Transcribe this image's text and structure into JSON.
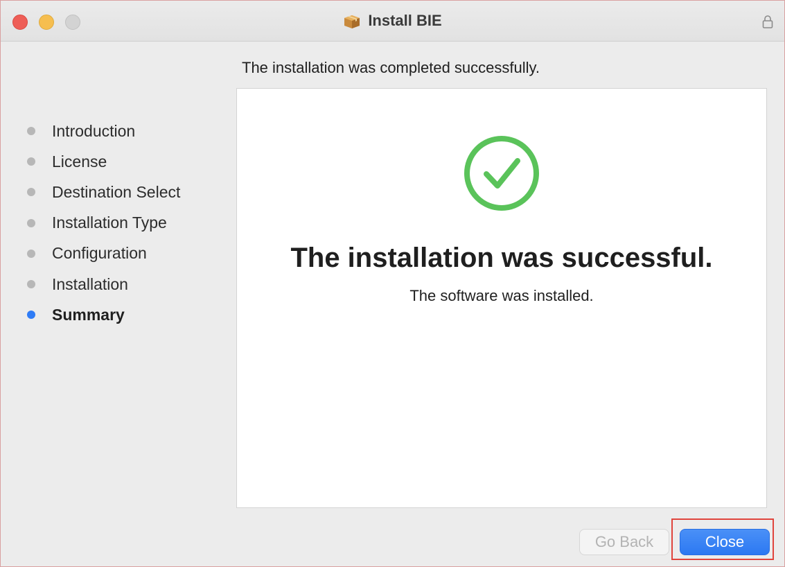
{
  "window": {
    "title": "Install BIE"
  },
  "header": {
    "status_text": "The installation was completed successfully."
  },
  "sidebar": {
    "steps": [
      {
        "label": "Introduction",
        "active": false
      },
      {
        "label": "License",
        "active": false
      },
      {
        "label": "Destination Select",
        "active": false
      },
      {
        "label": "Installation Type",
        "active": false
      },
      {
        "label": "Configuration",
        "active": false
      },
      {
        "label": "Installation",
        "active": false
      },
      {
        "label": "Summary",
        "active": true
      }
    ]
  },
  "main": {
    "icon": "check-circle-icon",
    "title": "The installation was successful.",
    "subtitle": "The software was installed."
  },
  "footer": {
    "go_back_label": "Go Back",
    "close_label": "Close"
  },
  "colors": {
    "accent": "#2f7cf6",
    "success": "#5ac35a",
    "highlight": "#e0443c"
  }
}
